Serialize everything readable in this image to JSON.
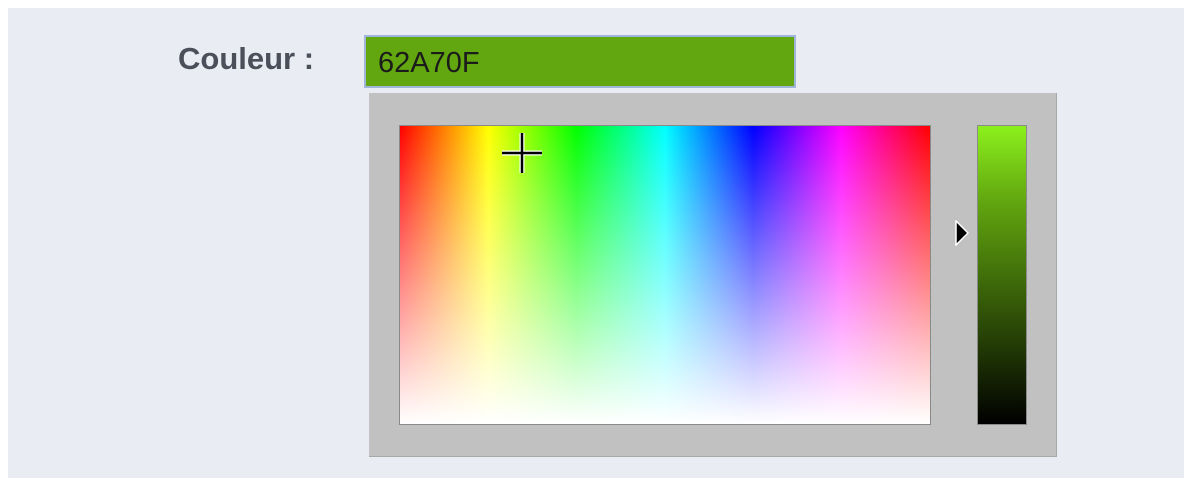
{
  "form": {
    "label": "Couleur :",
    "value": "62A70F"
  },
  "colors": {
    "background": "#e9ecf3",
    "selected": "#62A70F",
    "picker_frame": "#c1c1c1",
    "input_border": "#9fb5d9"
  },
  "picker": {
    "hue_fraction": 0.23,
    "saturation_fraction": 0.91,
    "brightness_fraction": 0.64,
    "hue_spectrum": [
      "#ff0000",
      "#ffff00",
      "#00ff00",
      "#00ffff",
      "#0000ff",
      "#ff00ff",
      "#ff0000"
    ]
  },
  "icons": {
    "crosshair": "crosshair-icon",
    "slider": "triangle-right-icon"
  }
}
